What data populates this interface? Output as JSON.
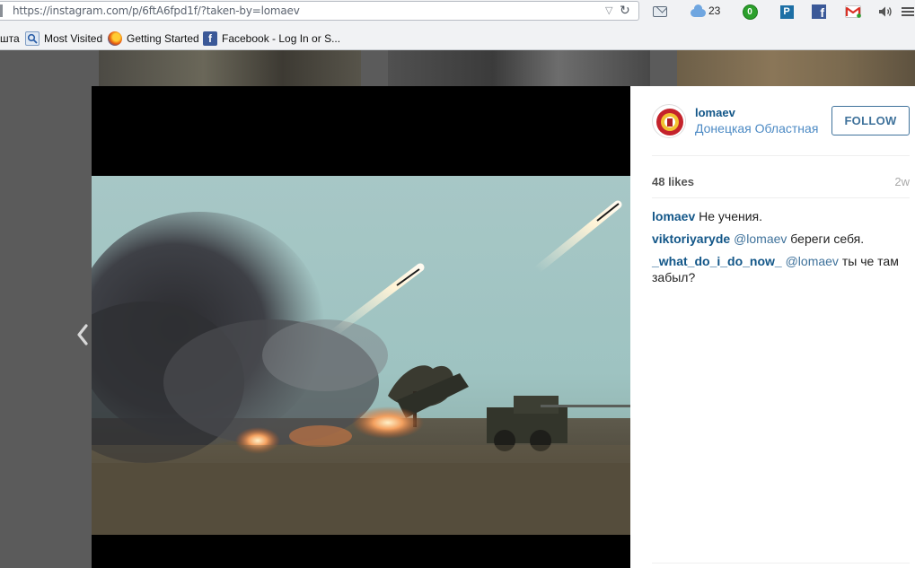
{
  "browser": {
    "url": "https://instagram.com/p/6ftA6fpd1f/?taken-by=lomaev",
    "weather_temp": "23",
    "badge_count": "0",
    "p_icon_letter": "P",
    "fb_icon_letter": "f",
    "icons": [
      "mail-icon",
      "weather-cloud-icon",
      "badge-icon",
      "p-icon",
      "facebook-icon",
      "gmail-icon",
      "volume-icon",
      "menu-icon",
      "dropdown-icon",
      "reload-icon"
    ]
  },
  "bookmarks": [
    {
      "label": "шта",
      "icon": ""
    },
    {
      "label": "Most Visited",
      "icon": "most-visited-icon"
    },
    {
      "label": "Getting Started",
      "icon": "firefox-icon"
    },
    {
      "label": "Facebook - Log In or S...",
      "icon": "facebook-icon"
    }
  ],
  "post": {
    "username": "lomaev",
    "location": "Донецкая Областная",
    "follow_label": "FOLLOW",
    "likes": "48 likes",
    "time_ago": "2w",
    "comments": [
      {
        "user": "lomaev",
        "mention": "",
        "text": "Не учения."
      },
      {
        "user": "viktoriyaryde",
        "mention": "@lomaev",
        "text": "береги себя."
      },
      {
        "user": "_what_do_i_do_now_",
        "mention": "@lomaev",
        "text": "ты че там забыл?"
      }
    ]
  },
  "colors": {
    "link_blue": "#125688",
    "follow_blue": "#3f729b",
    "overlay": "#5b5b5b"
  }
}
